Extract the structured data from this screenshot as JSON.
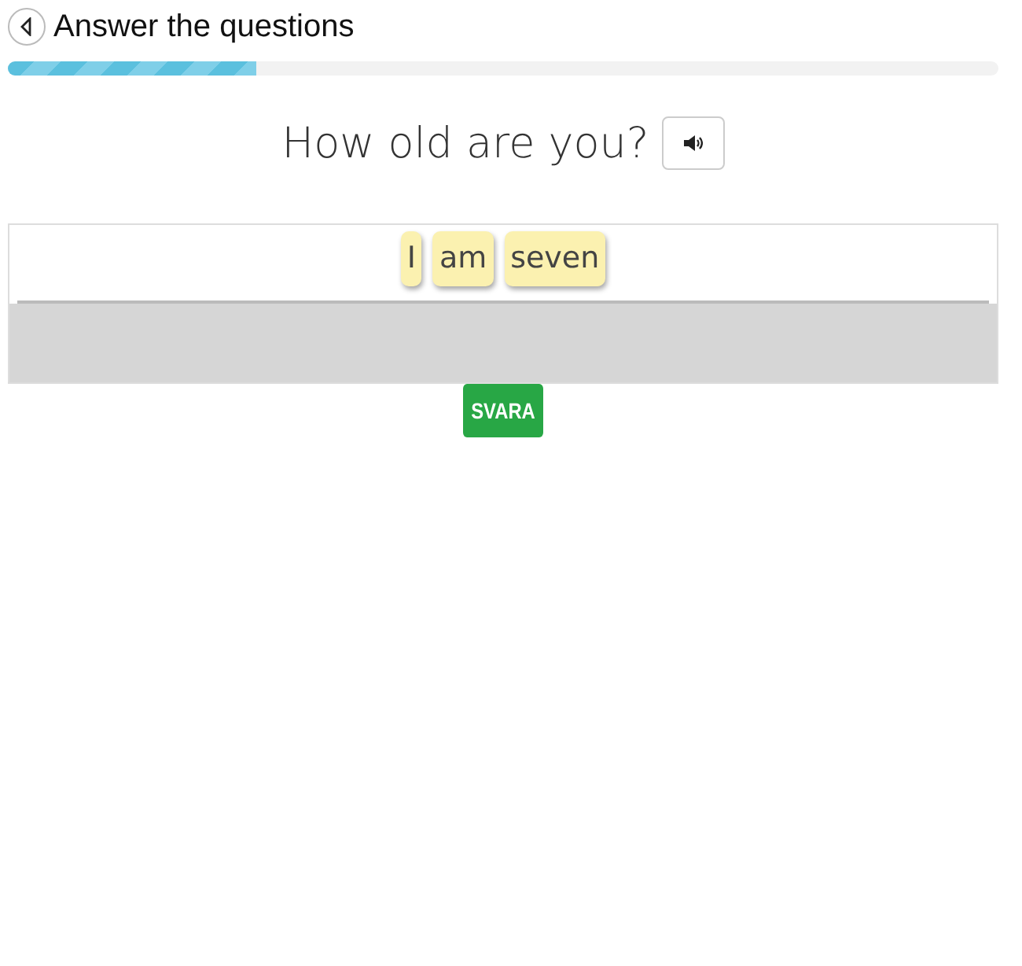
{
  "header": {
    "title": "Answer the questions"
  },
  "progress": {
    "level": 0.25
  },
  "question": {
    "text": "How old are you?"
  },
  "answer_tiles": [
    {
      "text": "I"
    },
    {
      "text": "am"
    },
    {
      "text": "seven"
    }
  ],
  "submit_button": {
    "label": "SVARA"
  }
}
